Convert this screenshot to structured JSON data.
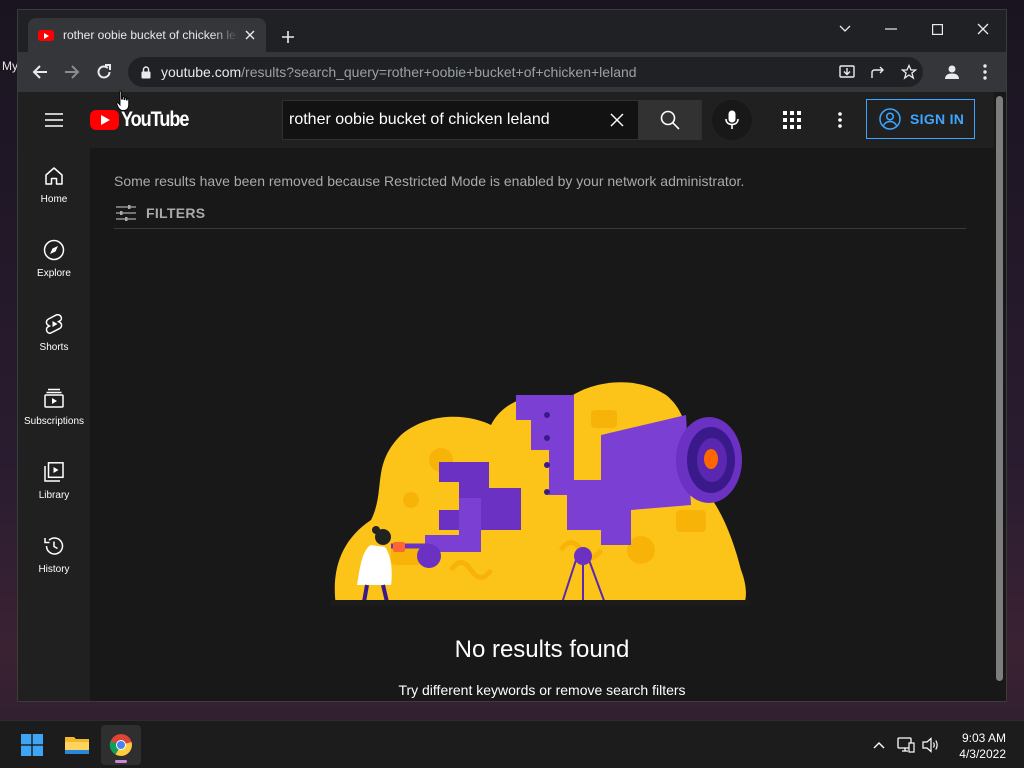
{
  "desktop": {
    "label": "My"
  },
  "browser": {
    "tab": {
      "title": "rother oobie bucket of chicken leland",
      "favicon": "youtube-icon"
    },
    "url_host": "youtube.com",
    "url_path": "/results?search_query=rother+oobie+bucket+of+chicken+leland"
  },
  "youtube": {
    "logo_text": "YouTube",
    "search": {
      "query": "rother oobie bucket of chicken leland"
    },
    "sign_in_label": "SIGN IN",
    "guide": [
      {
        "label": "Home",
        "icon": "home-icon"
      },
      {
        "label": "Explore",
        "icon": "compass-icon"
      },
      {
        "label": "Shorts",
        "icon": "shorts-icon"
      },
      {
        "label": "Subscriptions",
        "icon": "subscriptions-icon"
      },
      {
        "label": "Library",
        "icon": "library-icon"
      },
      {
        "label": "History",
        "icon": "history-icon"
      }
    ],
    "restricted_notice": "Some results have been removed because Restricted Mode is enabled by your network administrator.",
    "filters_label": "FILTERS",
    "no_results_title": "No results found",
    "no_results_subtitle": "Try different keywords or remove search filters"
  },
  "taskbar": {
    "apps": [
      "windows-start-icon",
      "file-explorer-icon",
      "chrome-icon"
    ],
    "time": "9:03 AM",
    "date": "4/3/2022"
  },
  "colors": {
    "accent_blue": "#3ea6ff",
    "youtube_red": "#ff0000",
    "illustration_yellow": "#fcc419",
    "illustration_purple": "#7b3fd3"
  }
}
